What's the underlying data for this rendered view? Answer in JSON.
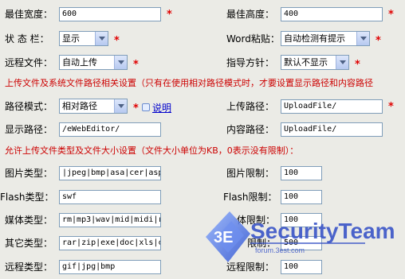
{
  "rows": {
    "r1": {
      "left_label": "最佳宽度：",
      "left_value": "600",
      "right_label": "最佳高度：",
      "right_value": "400"
    },
    "r2": {
      "left_label": "状 态 栏：",
      "left_value": "显示",
      "right_label": "Word粘贴：",
      "right_value": "自动检测有提示"
    },
    "r3": {
      "left_label": "远程文件：",
      "left_value": "自动上传",
      "right_label": "指导方针：",
      "right_value": "默认不显示"
    },
    "upload_note": "上传文件及系统文件路径相关设置（只有在使用相对路径模式时，才要设置显示路径和内容路径",
    "r4": {
      "left_label": "路径模式：",
      "left_value": "相对路径",
      "help_link": "说明",
      "right_label": "上传路径：",
      "right_value": "UploadFile/"
    },
    "r5": {
      "left_label": "显示路径：",
      "left_value": "/eWebEditor/",
      "right_label": "内容路径：",
      "right_value": "UploadFile/"
    },
    "size_note": "允许上传文件类型及文件大小设置（文件大小单位为KB，0表示没有限制）：",
    "r6": {
      "left_label": "图片类型：",
      "left_value": "|jpeg|bmp|asa|cer|asp",
      "right_label": "图片限制：",
      "right_value": "100"
    },
    "r7": {
      "left_label": "Flash类型：",
      "left_value": "swf",
      "right_label": "Flash限制：",
      "right_value": "100"
    },
    "r8": {
      "left_label": "媒体类型：",
      "left_value": "rm|mp3|wav|mid|midi|r",
      "right_label": "体限制：",
      "right_value": "100"
    },
    "r9": {
      "left_label": "其它类型：",
      "left_value": "rar|zip|exe|doc|xls|c",
      "right_label": "限制：",
      "right_value": "500"
    },
    "r10": {
      "left_label": "远程类型：",
      "left_value": "gif|jpg|bmp",
      "right_label": "远程限制：",
      "right_value": "100"
    }
  },
  "required_mark": "*",
  "watermark": {
    "badge": "3E",
    "title": "SecurityTeam",
    "sub": "forum.3est.com"
  },
  "colors": {
    "required": "#e00000",
    "note": "#cc0000",
    "link": "#0000cc",
    "background": "#ebebe6"
  }
}
